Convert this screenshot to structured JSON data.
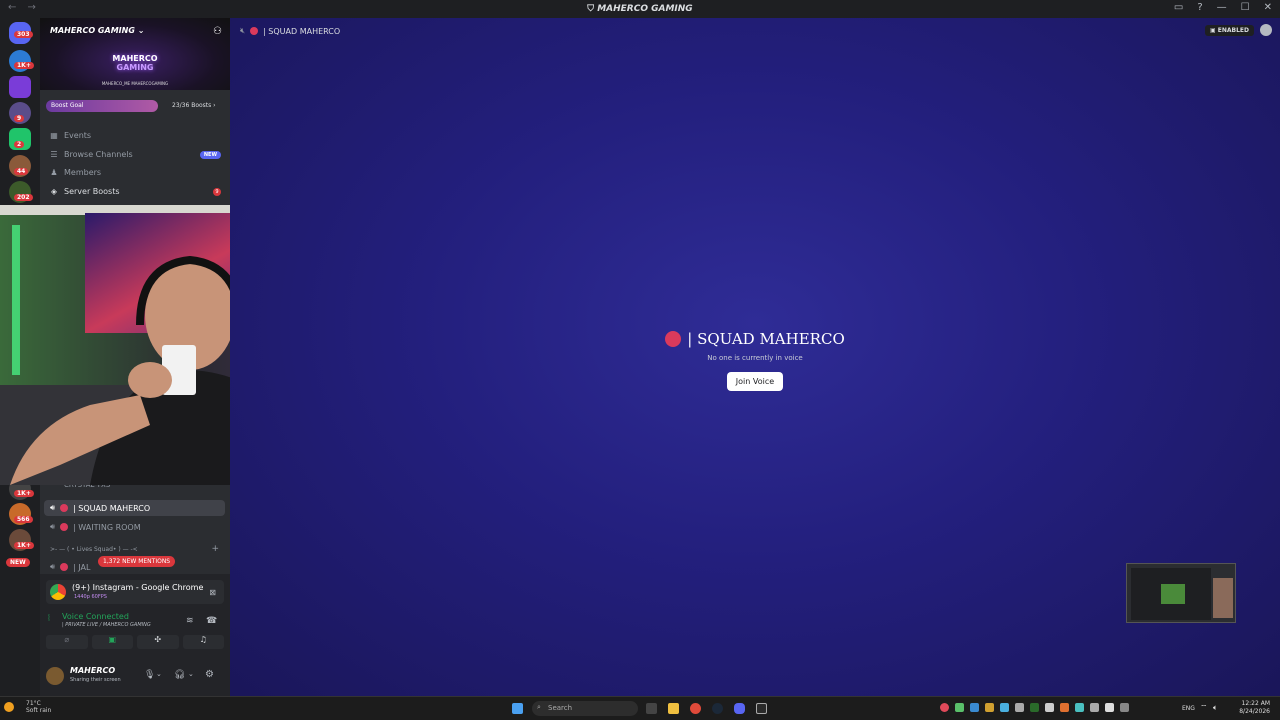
{
  "window": {
    "title": "MAHERCO GAMING",
    "nav": "← →"
  },
  "server_rail": {
    "badges": [
      "303",
      "1K+",
      "9",
      "2",
      "44",
      "202",
      "1K+",
      "566",
      "1K+"
    ],
    "new_label": "NEW"
  },
  "server_header": {
    "name": "MAHERCO GAMING",
    "logo_line1": "MAHERCO",
    "logo_line2": "GAMING",
    "handles": "MAHERCO_ME  MAHERCOGAMING"
  },
  "boost": {
    "label": "Boost Goal",
    "count": "23/36 Boosts ›"
  },
  "menu": {
    "events": "Events",
    "browse": "Browse Channels",
    "browse_badge": "NEW",
    "members": "Members",
    "server_boosts": "Server Boosts",
    "server_boosts_count": "9"
  },
  "channels": {
    "partial": "CRYSTAL TXS",
    "squad": "| SQUAD MAHERCO",
    "waiting": "| WAITING ROOM",
    "category": ">- — ( • Lives Squad• ) — -<",
    "jal_partial": "| JAL",
    "mentions": "1,372 NEW MENTIONS"
  },
  "stream": {
    "title": "(9+) Instagram - Google Chrome",
    "quality": "1440p 60FPS"
  },
  "voice": {
    "status": "Voice Connected",
    "channel": "| PRIVATE LIVE / MAHERCO GAMING"
  },
  "user": {
    "name": "MAHERCO",
    "status": "Sharing their screen"
  },
  "main": {
    "channel_name": "| SQUAD MAHERCO",
    "enabled_label": "ENABLED",
    "title": "| SQUAD MAHERCO",
    "subtitle": "No one is currently in voice",
    "join_label": "Join Voice"
  },
  "taskbar": {
    "temp": "71°C",
    "weather": "Soft rain",
    "search": "Search",
    "lang": "ENG",
    "time": "12:22 AM",
    "date": "8/24/2026"
  }
}
